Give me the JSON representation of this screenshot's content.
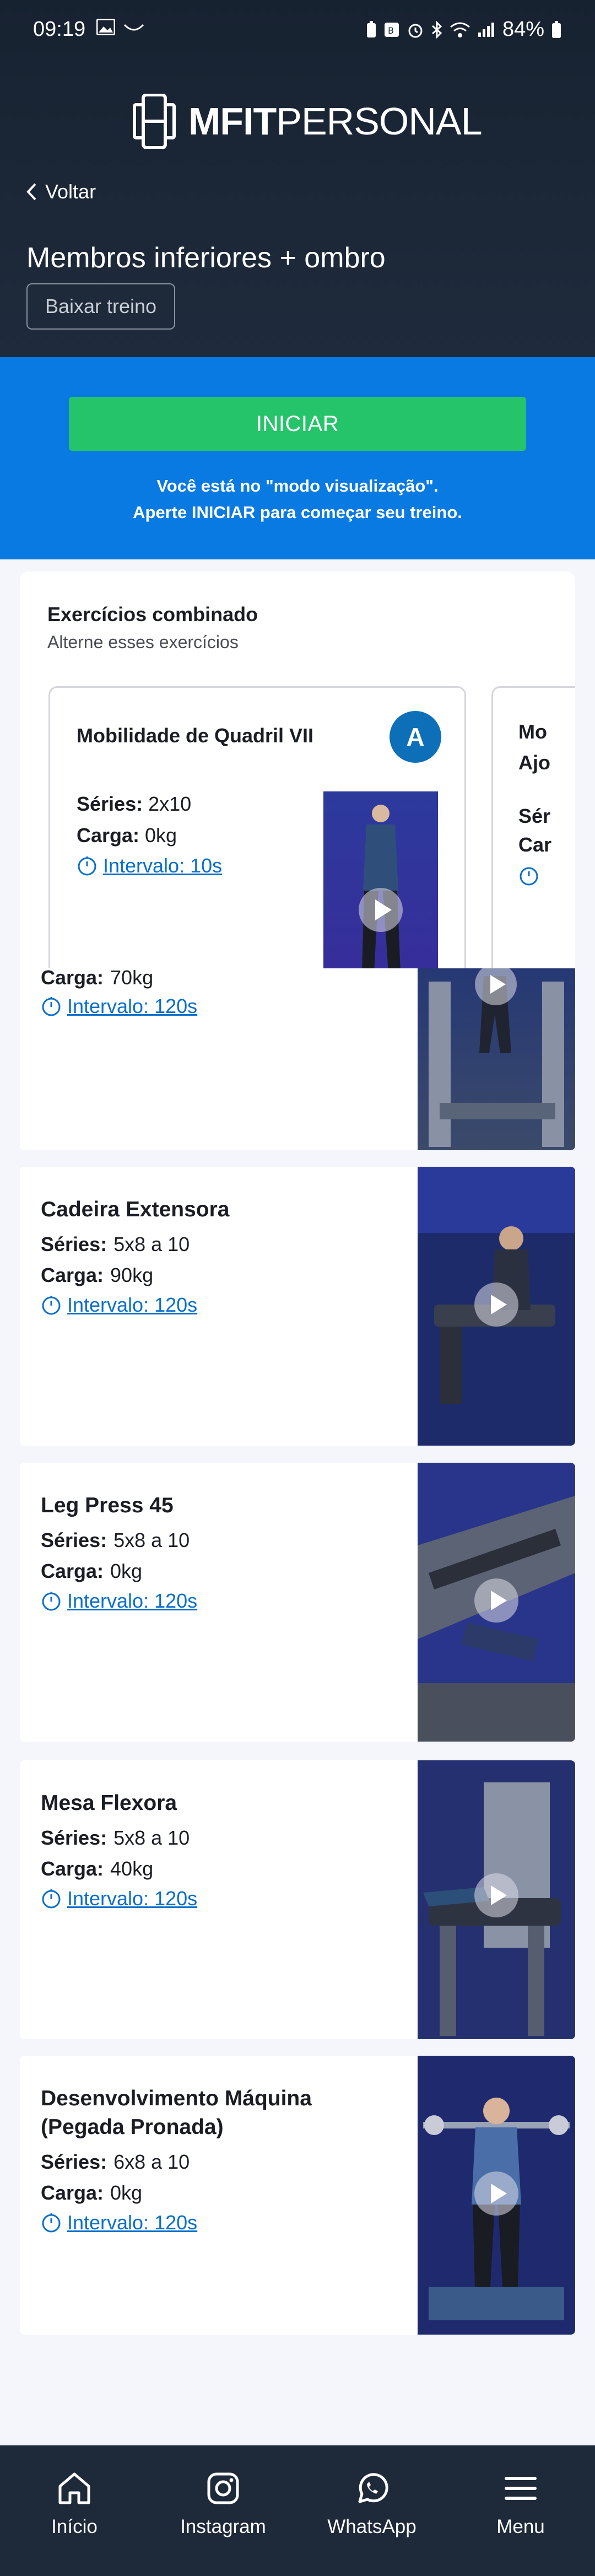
{
  "status_bar": {
    "time": "09:19",
    "battery": "84%"
  },
  "brand": {
    "bold": "MFIT",
    "light": "PERSONAL"
  },
  "header": {
    "back_label": "Voltar",
    "title": "Membros inferiores + ombro",
    "download_label": "Baixar treino"
  },
  "start": {
    "label": "INICIAR",
    "msg_line1": "Você está no \"modo visualização\".",
    "msg_line2": "Aperte INICIAR para começar seu treino."
  },
  "combined": {
    "title": "Exercícios combinado",
    "subtitle": "Alterne esses exercícios",
    "cards": [
      {
        "name": "Mobilidade de Quadril VII",
        "badge": "A",
        "series_label": "Séries:",
        "series": "2x10",
        "load_label": "Carga:",
        "load": "0kg",
        "interval": "Intervalo: 10s"
      },
      {
        "name_line1": "Mo",
        "name_line2": "Ajo",
        "series_label": "Sér",
        "load_label": "Car"
      }
    ]
  },
  "partial_exercise": {
    "load_label": "Carga:",
    "load": "70kg",
    "interval": "Intervalo: 120s"
  },
  "exercises": [
    {
      "name": "Cadeira Extensora",
      "series_label": "Séries:",
      "series": "5x8 a 10",
      "load_label": "Carga:",
      "load": "90kg",
      "interval": "Intervalo: 120s"
    },
    {
      "name": "Leg Press 45",
      "series_label": "Séries:",
      "series": "5x8 a 10",
      "load_label": "Carga:",
      "load": "0kg",
      "interval": "Intervalo: 120s"
    },
    {
      "name": "Mesa Flexora",
      "series_label": "Séries:",
      "series": "5x8 a 10",
      "load_label": "Carga:",
      "load": "40kg",
      "interval": "Intervalo: 120s"
    },
    {
      "name": "Desenvolvimento Máquina (Pegada Pronada)",
      "series_label": "Séries:",
      "series": "6x8 a 10",
      "load_label": "Carga:",
      "load": "0kg",
      "interval": "Intervalo: 120s"
    }
  ],
  "nav": [
    {
      "label": "Início",
      "icon": "home-icon"
    },
    {
      "label": "Instagram",
      "icon": "instagram-icon"
    },
    {
      "label": "WhatsApp",
      "icon": "whatsapp-icon"
    },
    {
      "label": "Menu",
      "icon": "menu-icon"
    }
  ],
  "colors": {
    "header": "#1b2636",
    "blue_band": "#0a7ae3",
    "start_button": "#25c46a",
    "badge": "#0d6fb8",
    "link": "#0a6fc9",
    "nav": "#1e2a3a"
  }
}
